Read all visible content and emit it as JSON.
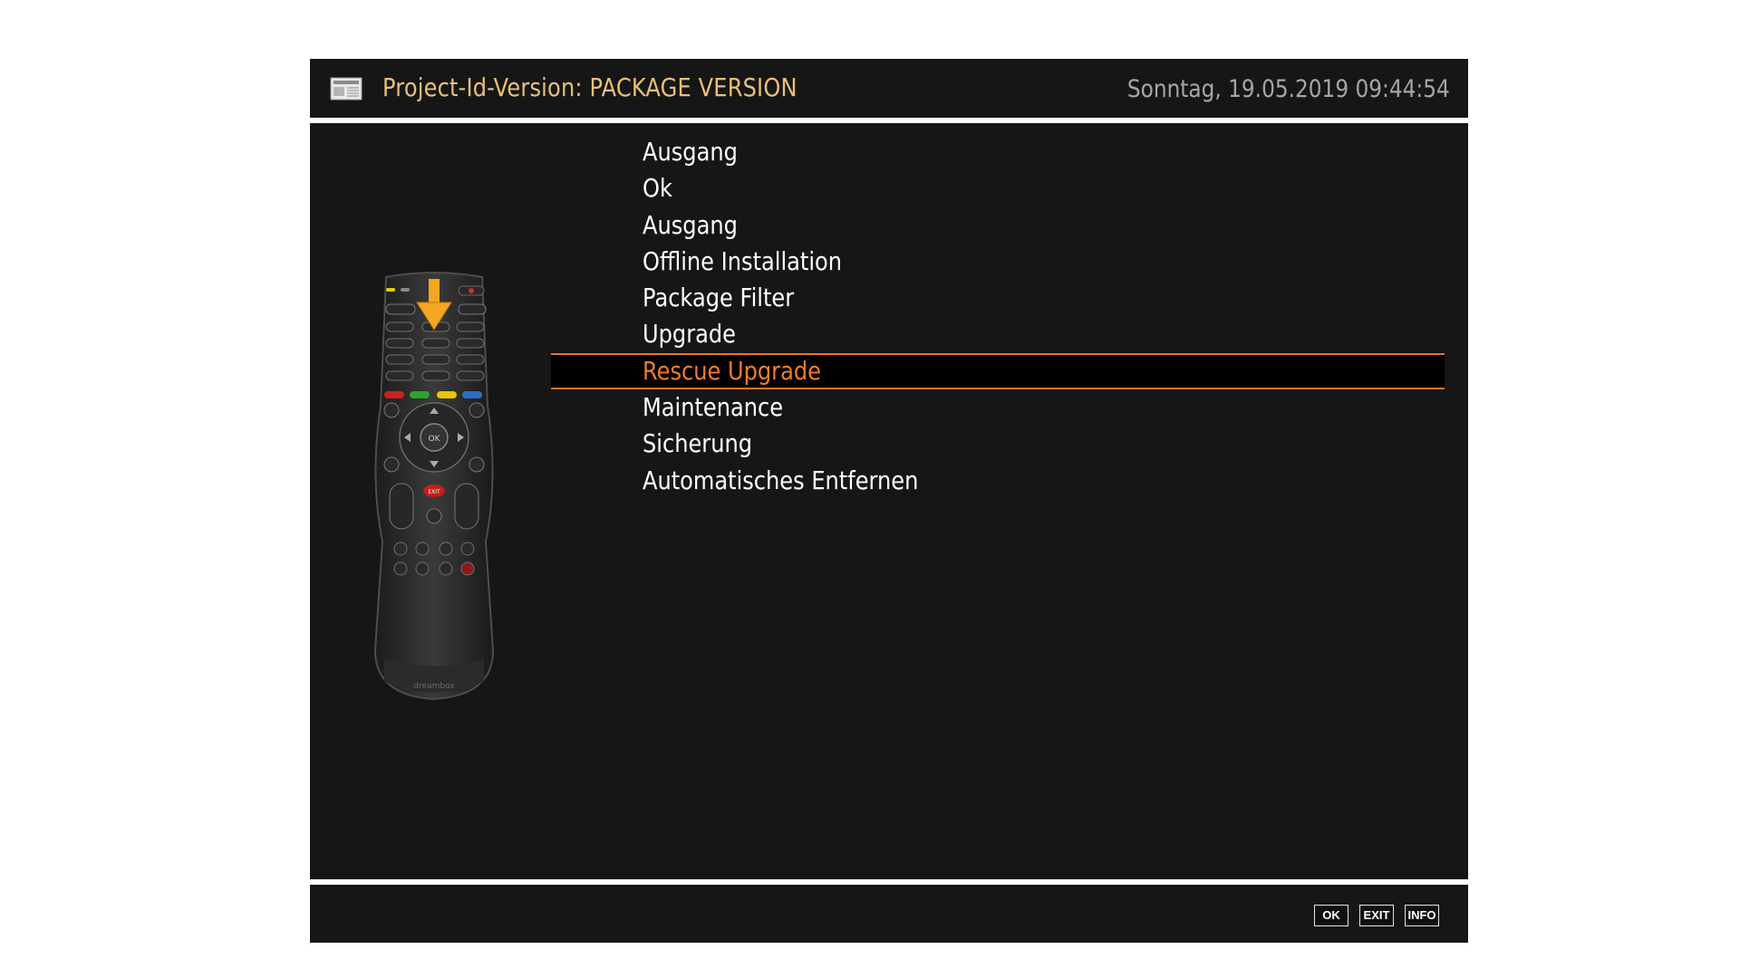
{
  "header": {
    "title": "Project-Id-Version: PACKAGE VERSION",
    "datetime": "Sonntag, 19.05.2019  09:44:54",
    "icon": "newspaper-icon"
  },
  "remote": {
    "icon": "remote-control-illustration",
    "brand": "dreambox",
    "ok_label": "OK",
    "exit_label": "EXIT",
    "arrow_color": "#f5a623"
  },
  "menu": {
    "items": [
      {
        "label": "Ausgang"
      },
      {
        "label": "Ok"
      },
      {
        "label": "Ausgang"
      },
      {
        "label": "Offline Installation"
      },
      {
        "label": "Package Filter"
      },
      {
        "label": "Upgrade"
      },
      {
        "label": "Rescue Upgrade"
      },
      {
        "label": "Maintenance"
      },
      {
        "label": "Sicherung"
      },
      {
        "label": "Automatisches Entfernen"
      }
    ],
    "selected_index": 6,
    "selected_color": "#f07c2a"
  },
  "footer": {
    "keys": [
      {
        "label": "OK"
      },
      {
        "label": "EXIT"
      },
      {
        "label": "INFO"
      }
    ]
  },
  "colors": {
    "panel": "#161616",
    "title": "#e8c07a",
    "date": "#a6a6a6",
    "accent": "#e8731f"
  }
}
